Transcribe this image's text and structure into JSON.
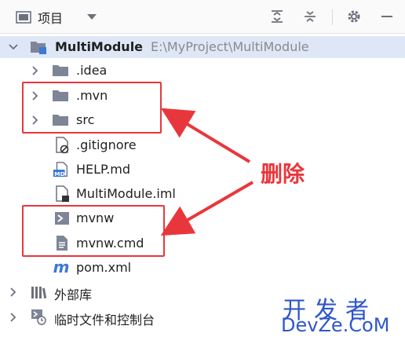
{
  "toolbar": {
    "title": "项目",
    "icons": [
      "project-view-icon",
      "dropdown-icon",
      "expand-all-icon",
      "collapse-all-icon",
      "gear-icon",
      "minimize-icon"
    ]
  },
  "tree": {
    "root": {
      "name": "MultiModule",
      "path": "E:\\MyProject\\MultiModule"
    },
    "items": [
      {
        "label": ".idea"
      },
      {
        "label": ".mvn"
      },
      {
        "label": "src"
      },
      {
        "label": ".gitignore"
      },
      {
        "label": "HELP.md"
      },
      {
        "label": "MultiModule.iml"
      },
      {
        "label": "mvnw"
      },
      {
        "label": "mvnw.cmd"
      },
      {
        "label": "pom.xml"
      },
      {
        "label": "外部库"
      },
      {
        "label": "临时文件和控制台"
      }
    ]
  },
  "annotation": {
    "text": "删除",
    "color": "#e8373c"
  },
  "watermark": {
    "line1": "开发者",
    "line2": "DevZe.CoM"
  }
}
